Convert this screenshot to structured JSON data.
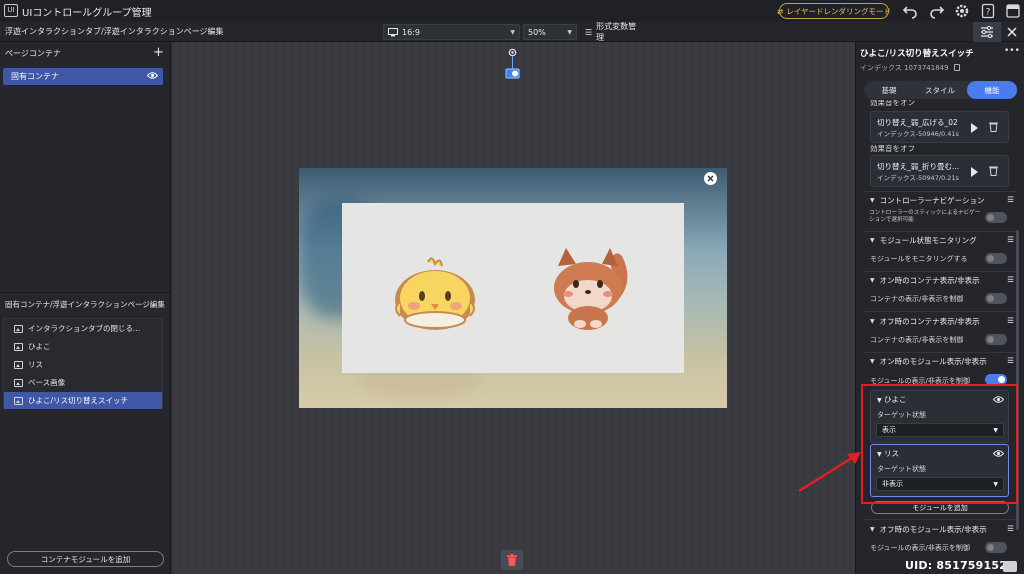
{
  "titlebar": {
    "logo": "UI",
    "title": "UIコントロールグループ管理",
    "layer_render_mode": "レイヤードレンダリングモード"
  },
  "toolbar": {
    "breadcrumb": "浮遊インタラクションタブ/浮遊インタラクションページ編集",
    "aspect_ratio": "16:9",
    "zoom": "50%",
    "format_vars": "形式変数管理"
  },
  "left_panel": {
    "header": "ページコンテナ",
    "container_item": "固有コンテナ",
    "edit_title": "固有コンテナ/浮遊インタラクションページ編集",
    "tree": [
      {
        "label": "インタラクションタブの閉じる..."
      },
      {
        "label": "ひよこ"
      },
      {
        "label": "リス"
      },
      {
        "label": "ベース画像"
      },
      {
        "label": "ひよこ/リス切り替えスイッチ"
      }
    ],
    "add_module": "コンテナモジュールを追加"
  },
  "right_panel": {
    "title": "ひよこ/リス切り替えスイッチ",
    "index": "インデックス 1073741849",
    "tabs": [
      "基礎",
      "スタイル",
      "機能"
    ],
    "cut_label": "効果音をオン",
    "sound_on": {
      "name": "切り替え_弱_広げる_02",
      "info": "インデックス-50946/0.41s"
    },
    "sound_off_label": "効果音をオフ",
    "sound_off": {
      "name": "切り替え_弱_折り畳む...",
      "info": "インデックス-50947/0.21s"
    },
    "sections": {
      "controller_nav": {
        "title": "コントローラーナビゲーション",
        "desc": "コントローラーのスティックによるナビゲーションで選択可能"
      },
      "module_monitor": {
        "title": "モジュール状態モニタリング",
        "desc": "モジュールをモニタリングする"
      },
      "on_container": {
        "title": "オン時のコンテナ表示/非表示",
        "desc": "コンテナの表示/非表示を制御"
      },
      "off_container": {
        "title": "オフ時のコンテナ表示/非表示",
        "desc": "コンテナの表示/非表示を制御"
      },
      "on_module": {
        "title": "オン時のモジュール表示/非表示",
        "desc": "モジュールの表示/非表示を制御"
      },
      "off_module": {
        "title": "オフ時のモジュール表示/非表示",
        "desc": "モジュールの表示/非表示を制御"
      }
    },
    "target_hiyoko": {
      "name": "ひよこ",
      "label": "ターゲット状態",
      "value": "表示"
    },
    "target_risu": {
      "name": "リス",
      "label": "ターゲット状態",
      "value": "非表示"
    },
    "add_module_btn": "モジュールを追加"
  },
  "uid": "UID: 851759152",
  "colors": {
    "accent": "#4a7cf0",
    "selection": "#3f57a5",
    "highlight": "#e51e25",
    "warning": "#e9c45a"
  }
}
